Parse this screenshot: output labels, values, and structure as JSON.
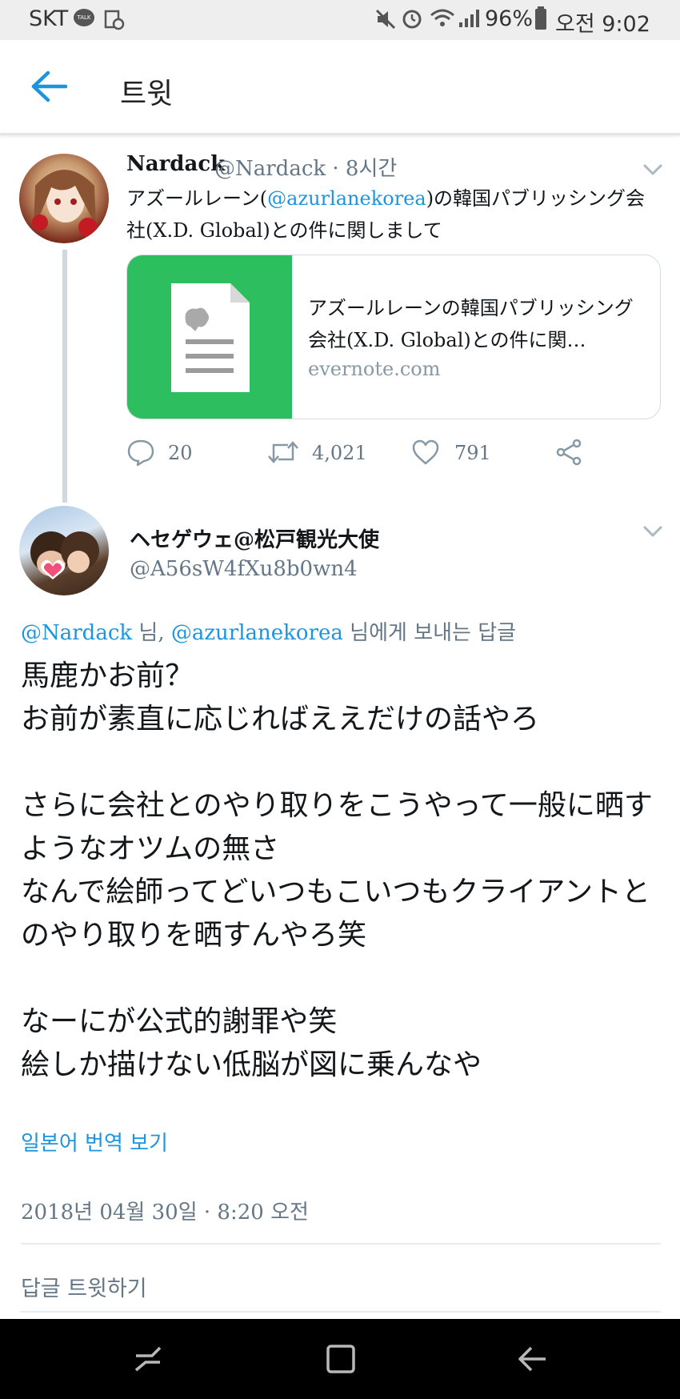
{
  "status_bar": {
    "carrier": "SKT",
    "talk_badge": "TALK",
    "battery": "96%",
    "time": "오전 9:02"
  },
  "app_bar": {
    "title": "트윗"
  },
  "parent_tweet": {
    "name": "Nardack",
    "handle_time": "@Nardack · 8시간",
    "text_before": "アズールレーン(",
    "mention": "@azurlanekorea",
    "text_after": ")の韓国パブリッシング会社(X.D. Global)との件に関しまして",
    "card": {
      "title": "アズールレーンの韓国パブリッシング会社(X.D. Global)との件に関…",
      "domain": "evernote.com"
    },
    "actions": {
      "replies": "20",
      "retweets": "4,021",
      "likes": "791"
    }
  },
  "reply_tweet": {
    "name": "ヘセゲウェ@松戸観光大使",
    "handle": "@A56sW4fXu8b0wn4",
    "reply_to": {
      "mention1": "@Nardack",
      "sep1": " 님, ",
      "mention2": "@azurlanekorea",
      "suffix": " 님에게 보내는 답글"
    },
    "text": "馬鹿かお前？\nお前が素直に応じればええだけの話やろ\n\nさらに会社とのやり取りをこうやって一般に晒すようなオツムの無さ\nなんで絵師ってどいつもこいつもクライアントとのやり取りを晒すんやろ笑\n\nなーにが公式的謝罪や笑\n絵しか描けない低脳が図に乗んなや",
    "translate_link": "일본어 번역 보기",
    "timestamp": "2018년 04월 30일 · 8:20 오전"
  },
  "reply_prompt": "답글 트윗하기",
  "colors": {
    "link_blue": "#1b95e0",
    "evernote_green": "#2dbe60"
  }
}
